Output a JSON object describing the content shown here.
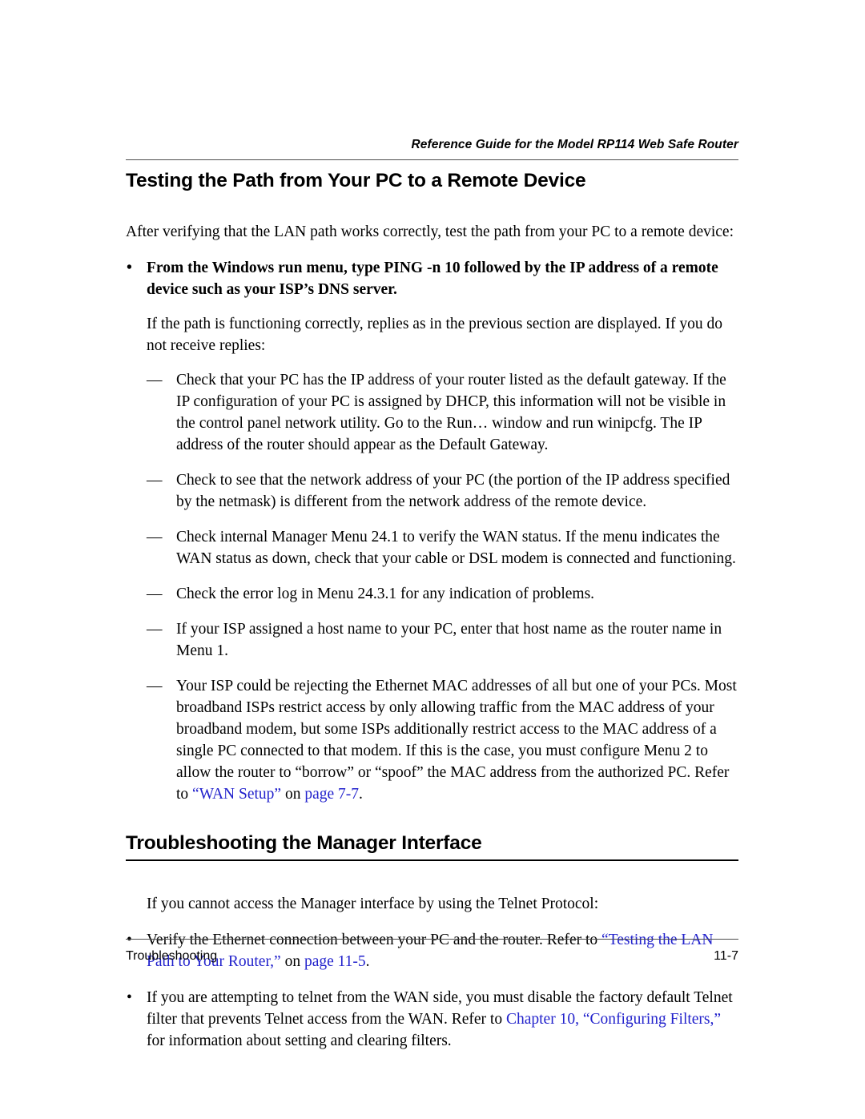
{
  "document": {
    "running_header": "Reference Guide for the Model RP114 Web Safe Router",
    "footer_left": "Troubleshooting",
    "footer_right": "11-7",
    "link_color": "#2222cc",
    "rule_color": "#4d4d4d"
  },
  "section_one": {
    "heading": "Testing the Path from Your PC to a Remote Device",
    "intro": "After verifying that the LAN path works correctly, test the path from your PC to a remote device:",
    "bullet_marker": "•",
    "bold_bullet": "From the Windows run menu, type PING -n 10 followed by the IP address of a remote device such as your ISP’s DNS server.",
    "sub_intro": "If the path is functioning correctly, replies as in the previous section are displayed. If you do not receive replies:",
    "dash_marker": "—",
    "dash_items": [
      "Check that your PC has the IP address of your router listed as the default gateway. If the IP configuration of your PC is assigned by DHCP, this information will not be visible in the control panel network utility. Go to the Run… window and run winipcfg. The IP address of the router should appear as the Default Gateway.",
      "Check to see that the network address of your PC (the portion of the IP address specified by the netmask) is different from the network address of the remote device.",
      "Check internal Manager Menu 24.1 to verify the WAN status. If the menu indicates the WAN status as down, check that your cable or DSL modem is connected and functioning.",
      "Check the error log in Menu 24.3.1 for any indication of problems.",
      "If your ISP assigned a host name to your PC, enter that host name as the router name in Menu 1."
    ],
    "dash_item_mac": {
      "text_before": "Your ISP could be rejecting the Ethernet MAC addresses of all but one of your PCs. Most broadband ISPs restrict access by only allowing traffic from the MAC address of your broadband modem, but some ISPs additionally restrict access to the MAC address of a single PC connected to that modem. If this is the case, you must configure Menu 2 to allow the router to “borrow” or “spoof” the MAC address from the authorized PC. Refer to ",
      "link_title": "“WAN Setup”",
      "text_mid": " on ",
      "link_page": "page 7-7",
      "text_after": "."
    }
  },
  "section_two": {
    "heading": "Troubleshooting the Manager Interface",
    "intro": "If you cannot access the Manager interface by using the Telnet Protocol:",
    "bullet_marker": "•",
    "bullet_one": {
      "text_before": "Verify the Ethernet connection between your PC and the router. Refer to ",
      "link_title": "“Testing the LAN Path to Your Router,”",
      "text_mid": " on ",
      "link_page": "page 11-5",
      "text_after": "."
    },
    "bullet_two": {
      "text_before": "If you are attempting to telnet from the WAN side, you must disable the factory default Telnet filter that prevents Telnet access from the WAN. Refer to ",
      "link_title": "Chapter 10, “Configuring Filters,”",
      "text_after": " for information about setting and clearing filters."
    }
  }
}
